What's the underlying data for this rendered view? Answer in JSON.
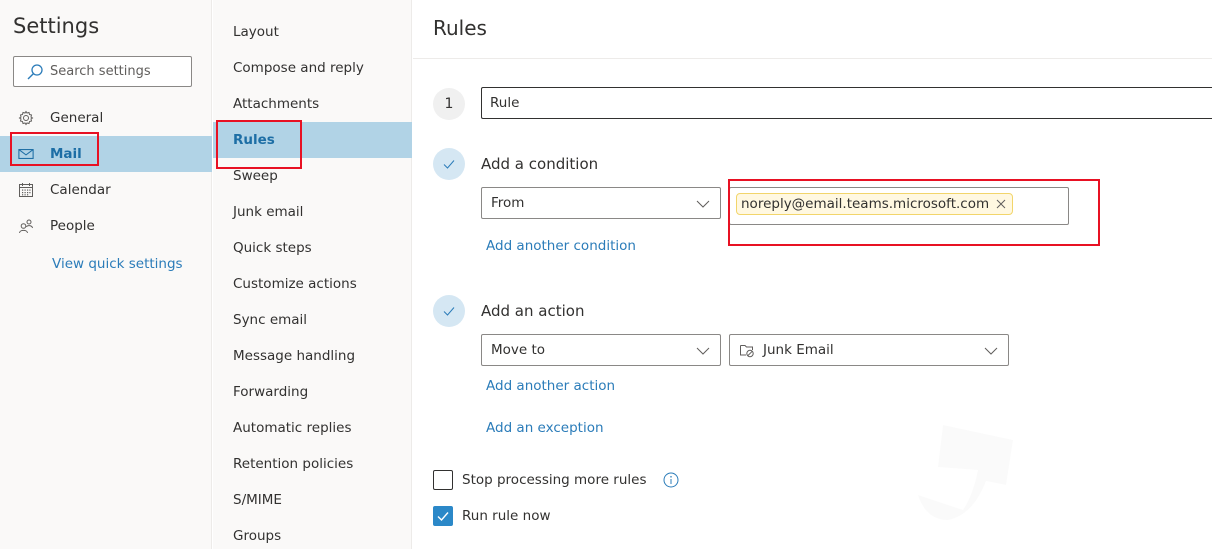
{
  "settings": {
    "title": "Settings",
    "search_placeholder": "Search settings",
    "nav": [
      {
        "label": "General",
        "icon": "gear-icon",
        "selected": false
      },
      {
        "label": "Mail",
        "icon": "mail-icon",
        "selected": true
      },
      {
        "label": "Calendar",
        "icon": "calendar-icon",
        "selected": false
      },
      {
        "label": "People",
        "icon": "people-icon",
        "selected": false
      }
    ],
    "quick_settings_link": "View quick settings"
  },
  "mail_nav": {
    "items": [
      {
        "label": "Layout",
        "selected": false
      },
      {
        "label": "Compose and reply",
        "selected": false
      },
      {
        "label": "Attachments",
        "selected": false
      },
      {
        "label": "Rules",
        "selected": true
      },
      {
        "label": "Sweep",
        "selected": false
      },
      {
        "label": "Junk email",
        "selected": false
      },
      {
        "label": "Quick steps",
        "selected": false
      },
      {
        "label": "Customize actions",
        "selected": false
      },
      {
        "label": "Sync email",
        "selected": false
      },
      {
        "label": "Message handling",
        "selected": false
      },
      {
        "label": "Forwarding",
        "selected": false
      },
      {
        "label": "Automatic replies",
        "selected": false
      },
      {
        "label": "Retention policies",
        "selected": false
      },
      {
        "label": "S/MIME",
        "selected": false
      },
      {
        "label": "Groups",
        "selected": false
      }
    ]
  },
  "rules": {
    "title": "Rules",
    "step_number": "1",
    "rule_name": "Rule",
    "condition": {
      "heading": "Add a condition",
      "field": "From",
      "recipients": [
        "noreply@email.teams.microsoft.com"
      ],
      "add_link": "Add another condition"
    },
    "action": {
      "heading": "Add an action",
      "type": "Move to",
      "folder": "Junk Email",
      "add_link": "Add another action"
    },
    "exception_link": "Add an exception",
    "stop_processing": {
      "label": "Stop processing more rules",
      "checked": false
    },
    "run_now": {
      "label": "Run rule now",
      "checked": true
    }
  },
  "colors": {
    "accent": "#2b7cb9",
    "selected_bg": "#b1d3e6",
    "annotation_red": "#e81123",
    "tag_bg": "#fff8e1"
  }
}
